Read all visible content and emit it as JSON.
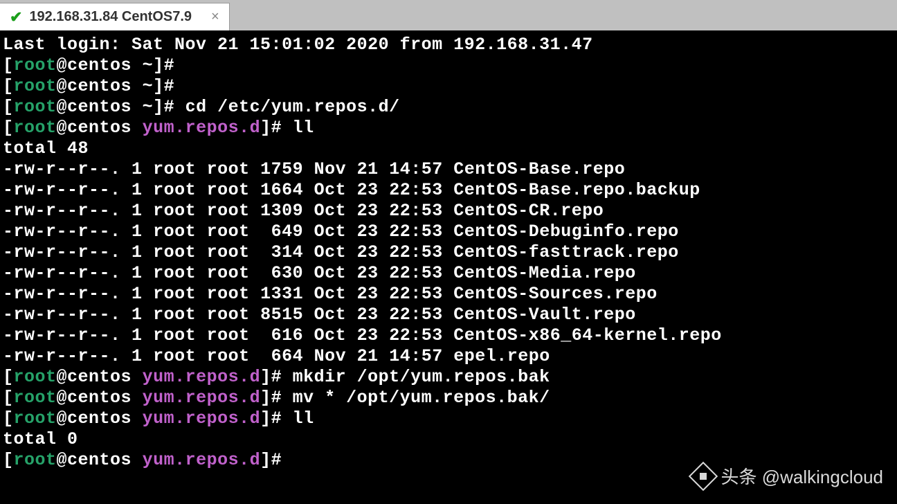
{
  "tab": {
    "title": "192.168.31.84 CentOS7.9"
  },
  "login_line": "Last login: Sat Nov 21 15:01:02 2020 from 192.168.31.47",
  "prompt": {
    "user": "root",
    "host": "centos",
    "home": "~",
    "dir": "yum.repos.d"
  },
  "commands": {
    "cd": "cd /etc/yum.repos.d/",
    "ll": "ll",
    "mkdir": "mkdir /opt/yum.repos.bak",
    "mv": "mv * /opt/yum.repos.bak/"
  },
  "ll_output": {
    "total1": "total 48",
    "total2": "total 0",
    "rows": [
      {
        "perm": "-rw-r--r--.",
        "links": "1",
        "owner": "root",
        "group": "root",
        "size": "1759",
        "date": "Nov 21 14:57",
        "name": "CentOS-Base.repo"
      },
      {
        "perm": "-rw-r--r--.",
        "links": "1",
        "owner": "root",
        "group": "root",
        "size": "1664",
        "date": "Oct 23 22:53",
        "name": "CentOS-Base.repo.backup"
      },
      {
        "perm": "-rw-r--r--.",
        "links": "1",
        "owner": "root",
        "group": "root",
        "size": "1309",
        "date": "Oct 23 22:53",
        "name": "CentOS-CR.repo"
      },
      {
        "perm": "-rw-r--r--.",
        "links": "1",
        "owner": "root",
        "group": "root",
        "size": " 649",
        "date": "Oct 23 22:53",
        "name": "CentOS-Debuginfo.repo"
      },
      {
        "perm": "-rw-r--r--.",
        "links": "1",
        "owner": "root",
        "group": "root",
        "size": " 314",
        "date": "Oct 23 22:53",
        "name": "CentOS-fasttrack.repo"
      },
      {
        "perm": "-rw-r--r--.",
        "links": "1",
        "owner": "root",
        "group": "root",
        "size": " 630",
        "date": "Oct 23 22:53",
        "name": "CentOS-Media.repo"
      },
      {
        "perm": "-rw-r--r--.",
        "links": "1",
        "owner": "root",
        "group": "root",
        "size": "1331",
        "date": "Oct 23 22:53",
        "name": "CentOS-Sources.repo"
      },
      {
        "perm": "-rw-r--r--.",
        "links": "1",
        "owner": "root",
        "group": "root",
        "size": "8515",
        "date": "Oct 23 22:53",
        "name": "CentOS-Vault.repo"
      },
      {
        "perm": "-rw-r--r--.",
        "links": "1",
        "owner": "root",
        "group": "root",
        "size": " 616",
        "date": "Oct 23 22:53",
        "name": "CentOS-x86_64-kernel.repo"
      },
      {
        "perm": "-rw-r--r--.",
        "links": "1",
        "owner": "root",
        "group": "root",
        "size": " 664",
        "date": "Nov 21 14:57",
        "name": "epel.repo"
      }
    ]
  },
  "watermark": {
    "prefix": "头条",
    "text": "@walkingcloud"
  }
}
